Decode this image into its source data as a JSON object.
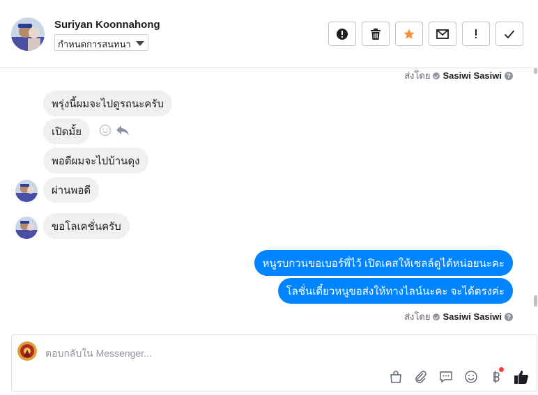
{
  "header": {
    "contact_name": "Suriyan Koonnahong",
    "label_select": "กำหนดการสนทนา",
    "actions": [
      {
        "name": "mark-spam-icon",
        "icon": "exclamation-circle"
      },
      {
        "name": "delete-icon",
        "icon": "trash"
      },
      {
        "name": "star-icon",
        "icon": "star"
      },
      {
        "name": "mark-unread-icon",
        "icon": "envelope"
      },
      {
        "name": "follow-up-icon",
        "icon": "exclamation"
      },
      {
        "name": "mark-done-icon",
        "icon": "check"
      }
    ],
    "star_color": "#f7923b"
  },
  "thread": {
    "sent_by_label": "ส่งโดย",
    "sender": "Sasiwi Sasiwi",
    "incoming": [
      "พรุ่งนี้ผมจะไปดูรถนะครับ",
      "เปิดมั้ย",
      "พอดีผมจะไปบ้านดุง",
      "ผ่านพอดี",
      "ขอโลเคชั่นครับ"
    ],
    "outgoing": [
      "หนูรบกวนขอเบอร์พี่ไว้ เปิดเคสให้เซลล์ดูได้หน่อยนะคะ",
      "โลชั่นเดี๋ยวหนูขอส่งให้ทางไลน์นะคะ จะได้ตรงค่ะ"
    ],
    "outgoing_color": "#0084ff",
    "incoming_color": "#f0f0f0"
  },
  "composer": {
    "placeholder": "ตอบกลับใน Messenger...",
    "tools": [
      "bag-icon",
      "attachment-icon",
      "saved-replies-icon",
      "emoji-icon",
      "payment-icon",
      "like-icon"
    ]
  }
}
